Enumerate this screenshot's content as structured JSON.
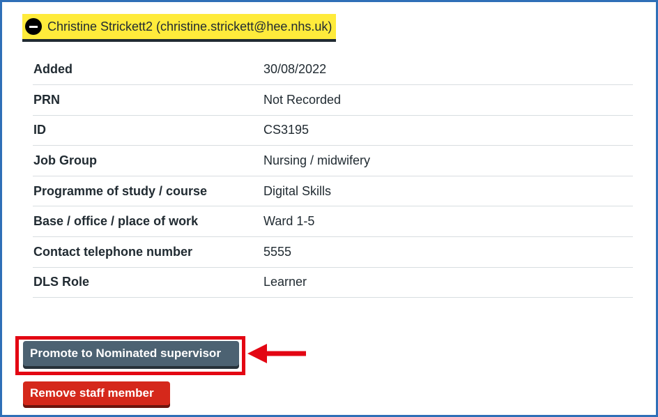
{
  "details": {
    "summary": "Christine Strickett2 (christine.strickett@hee.nhs.uk)"
  },
  "rows": [
    {
      "key": "Added",
      "value": "30/08/2022"
    },
    {
      "key": "PRN",
      "value": "Not Recorded"
    },
    {
      "key": "ID",
      "value": "CS3195"
    },
    {
      "key": "Job Group",
      "value": "Nursing / midwifery"
    },
    {
      "key": "Programme of study / course",
      "value": "Digital Skills"
    },
    {
      "key": "Base / office / place of work",
      "value": "Ward 1-5"
    },
    {
      "key": "Contact telephone number",
      "value": "5555"
    },
    {
      "key": "DLS Role",
      "value": "Learner"
    }
  ],
  "actions": {
    "promote_label": "Promote to Nominated supervisor",
    "remove_label": "Remove staff member"
  },
  "colors": {
    "highlight": "#ffeb3b",
    "promote_button": "#4c6272",
    "remove_button": "#d5281b",
    "annotation": "#e30613",
    "frame": "#2f6fb7"
  },
  "icons": {
    "summary_toggle": "minus-circle-icon",
    "annotation": "arrow-left-icon"
  }
}
